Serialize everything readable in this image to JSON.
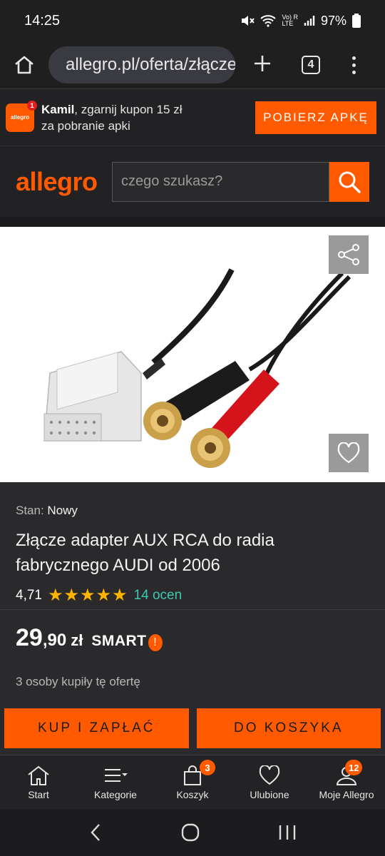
{
  "status_bar": {
    "time": "14:25",
    "battery": "97%",
    "signal_label_top": "Vo) R",
    "signal_label_bottom": "LTE"
  },
  "browser": {
    "url": "allegro.pl/oferta/złącze",
    "tab_count": "4"
  },
  "promo": {
    "user": "Kamil",
    "text_line1": ", zgarnij kupon 15 zł",
    "text_line2": "za pobranie apki",
    "button": "POBIERZ APKĘ",
    "logo_text": "allegro",
    "badge": "1"
  },
  "header": {
    "brand": "allegro",
    "search_placeholder": "czego szukasz?"
  },
  "product": {
    "condition_label": "Stan: ",
    "condition_value": "Nowy",
    "title": "Złącze adapter AUX RCA do radia fabrycznego AUDI od 2006",
    "rating": "4,71",
    "rating_stars": 5,
    "rating_count": "14 ocen",
    "price_int": "29",
    "price_frac": ",90",
    "currency": "zł",
    "smart_label": "SMART",
    "bought_text": "3 osoby kupiły tę ofertę"
  },
  "actions": {
    "buy": "KUP I ZAPŁAĆ",
    "cart": "DO KOSZYKA"
  },
  "nav": {
    "items": [
      {
        "label": "Start",
        "icon": "home-icon"
      },
      {
        "label": "Kategorie",
        "icon": "menu-icon"
      },
      {
        "label": "Koszyk",
        "icon": "cart-icon",
        "badge": "3"
      },
      {
        "label": "Ulubione",
        "icon": "heart-icon"
      },
      {
        "label": "Moje Allegro",
        "icon": "user-icon",
        "badge": "12"
      }
    ]
  },
  "colors": {
    "accent": "#ff5a00",
    "rating": "#ffb400",
    "rating_count": "#3cc9b0"
  }
}
